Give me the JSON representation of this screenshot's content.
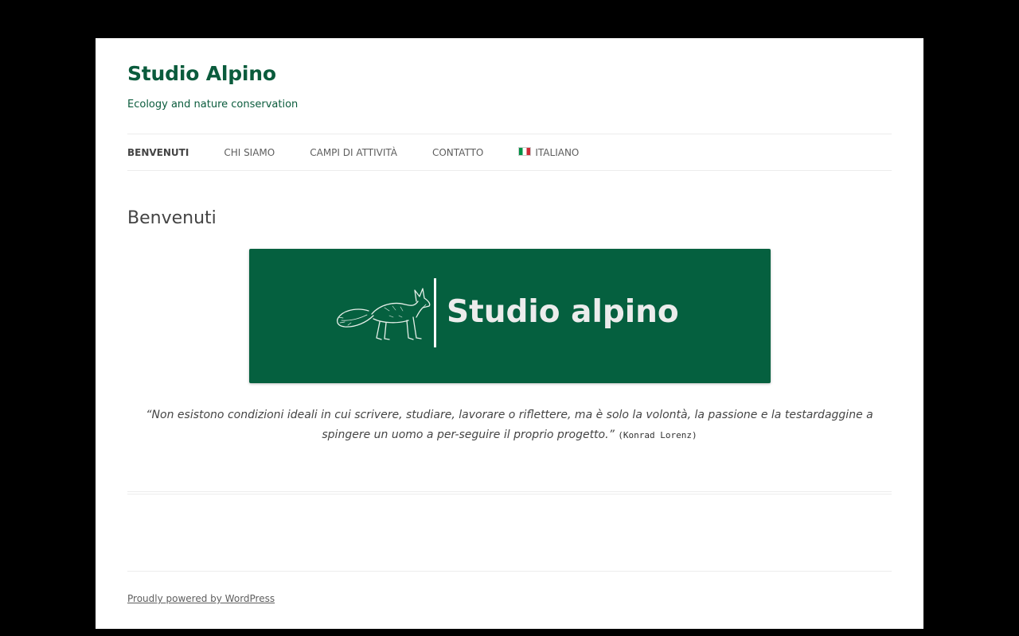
{
  "site": {
    "title": "Studio Alpino",
    "tagline": "Ecology and nature conservation"
  },
  "nav": {
    "items": [
      {
        "label": "BENVENUTI",
        "current": true
      },
      {
        "label": "CHI SIAMO"
      },
      {
        "label": "CAMPI DI ATTIVITÀ"
      },
      {
        "label": "CONTATTO"
      },
      {
        "label": "ITALIANO",
        "icon": "italian-flag-icon"
      }
    ]
  },
  "main": {
    "title": "Benvenuti",
    "banner": {
      "text": "Studio alpino",
      "icon": "fox-logo-icon",
      "background": "#05603f"
    },
    "quote": {
      "open_mark": "“",
      "text": "Non esistono condizioni ideali in cui scrivere, studiare, lavorare o riflettere, ma è solo la volontà, la passione e la testardaggine a spingere un uomo a per-seguire il proprio progetto.",
      "close_mark": "”",
      "author": "(Konrad Lorenz)"
    }
  },
  "footer": {
    "powered_by": "Proudly powered by WordPress"
  },
  "colors": {
    "brand_green": "#0a5b3c",
    "outer_background": "#000000",
    "page_background": "#ffffff"
  }
}
